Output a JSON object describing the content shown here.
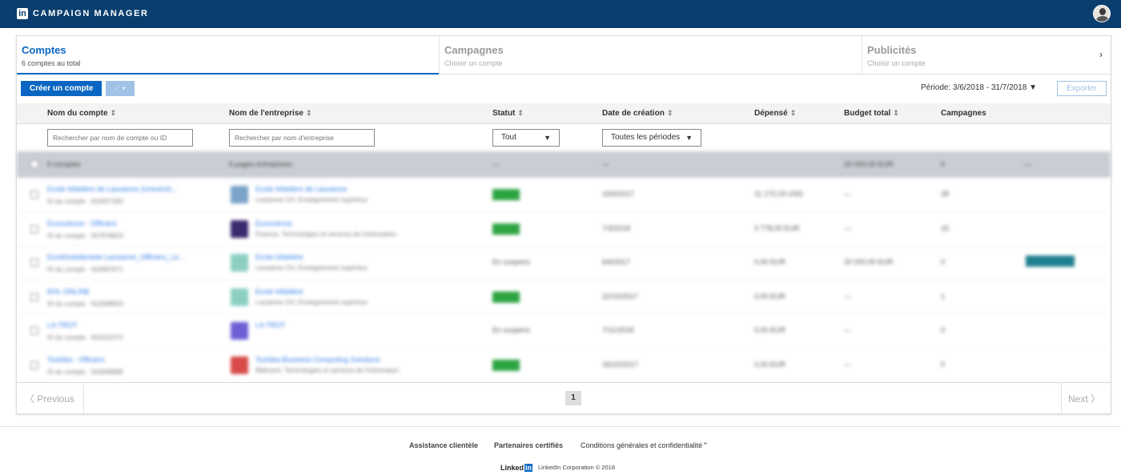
{
  "header": {
    "brand": "CAMPAIGN MANAGER",
    "logo_text": "in"
  },
  "tabs": [
    {
      "title": "Comptes",
      "subtitle": "6 comptes au total"
    },
    {
      "title": "Campagnes",
      "subtitle": "Choisir un compte"
    },
    {
      "title": "Publicités",
      "subtitle": "Choisir un compte"
    }
  ],
  "toolbar": {
    "create_label": "Créer un compte",
    "period_label": "Période:",
    "period_value": "3/6/2018 - 31/7/2018",
    "export_label": "Exporter"
  },
  "columns": {
    "account": "Nom du compte",
    "company": "Nom de l'entreprise",
    "status": "Statut",
    "created": "Date de création",
    "spent": "Dépensé",
    "budget": "Budget total",
    "campaigns": "Campagnes"
  },
  "filters": {
    "account_placeholder": "Rechercher par nom de compte ou ID",
    "company_placeholder": "Rechercher par nom d'entreprise",
    "status_value": "Tout",
    "period_value": "Toutes les périodes"
  },
  "summary": {
    "accounts": "6 comptes",
    "companies": "6 pages entreprises",
    "status": "—",
    "created": "—",
    "budget": "20 000,00 EUR",
    "campaigns": "0",
    "extra": "—"
  },
  "rows": [
    {
      "name": "Ecole hôtelière de Lausanne (Universit...",
      "id": "ID du compte · 502657283",
      "company": "Ecole hôtelière de Lausanne",
      "industry": "Lausanne CH, Enseignement supérieur",
      "status": "",
      "created": "15/6/2017",
      "spent": "11 172,03 USD",
      "budget": "—",
      "campaigns": "28",
      "logo_color": "#7aa3c8"
    },
    {
      "name": "Ecoscience - Officiers",
      "id": "ID du compte · 507878823",
      "company": "Ecoscience",
      "industry": "Finance, Technologies et services de l'information",
      "status": "",
      "created": "7/3/2018",
      "spent": "3 778,00 EUR",
      "budget": "—",
      "campaigns": "15",
      "logo_color": "#3b2a6e"
    },
    {
      "name": "Ecolehotelleriede Lausanne_Officiers_Le...",
      "id": "ID du compte · 502897871",
      "company": "Ecole hôtelière",
      "industry": "Lausanne CH, Enseignement supérieur",
      "status": "En suspens",
      "created": "6/6/2017",
      "spent": "0,00 EUR",
      "budget": "20 000,00 EUR",
      "campaigns": "0",
      "logo_color": "#8ccfc2"
    },
    {
      "name": "EHL ONLINE",
      "id": "ID du compte · 503098833",
      "company": "Ecole hôtelière",
      "industry": "Lausanne CH, Enseignement supérieur",
      "status": "",
      "created": "22/10/2017",
      "spent": "0,00 EUR",
      "budget": "—",
      "campaigns": "1",
      "logo_color": "#8ccfc2"
    },
    {
      "name": "LA TROT",
      "id": "ID du compte · 503102372",
      "company": "LA TROT",
      "industry": "",
      "status": "En suspens",
      "created": "7/11/2018",
      "spent": "0,00 EUR",
      "budget": "—",
      "campaigns": "0",
      "logo_color": "#6c5fd6"
    },
    {
      "name": "Toshiba - Officiers",
      "id": "ID du compte · 503098888",
      "company": "Toshiba Business Computing Solutions",
      "industry": "Bâtiment, Technologies et services de l'information",
      "status": "",
      "created": "16/10/2017",
      "spent": "0,00 EUR",
      "budget": "—",
      "campaigns": "0",
      "logo_color": "#d84a4a"
    }
  ],
  "pager": {
    "previous": "Previous",
    "next": "Next",
    "page": "1"
  },
  "footer": {
    "links": [
      "Assistance clientèle",
      "Partenaires certifiés",
      "Conditions générales et confidentialité"
    ],
    "logo_text": "Linked",
    "logo_in": "in",
    "copyright": "LinkedIn Corporation © 2018"
  },
  "colors": {
    "topbar": "#0a3e6e",
    "accent": "#0a66c2",
    "status_active": "#2da442"
  }
}
